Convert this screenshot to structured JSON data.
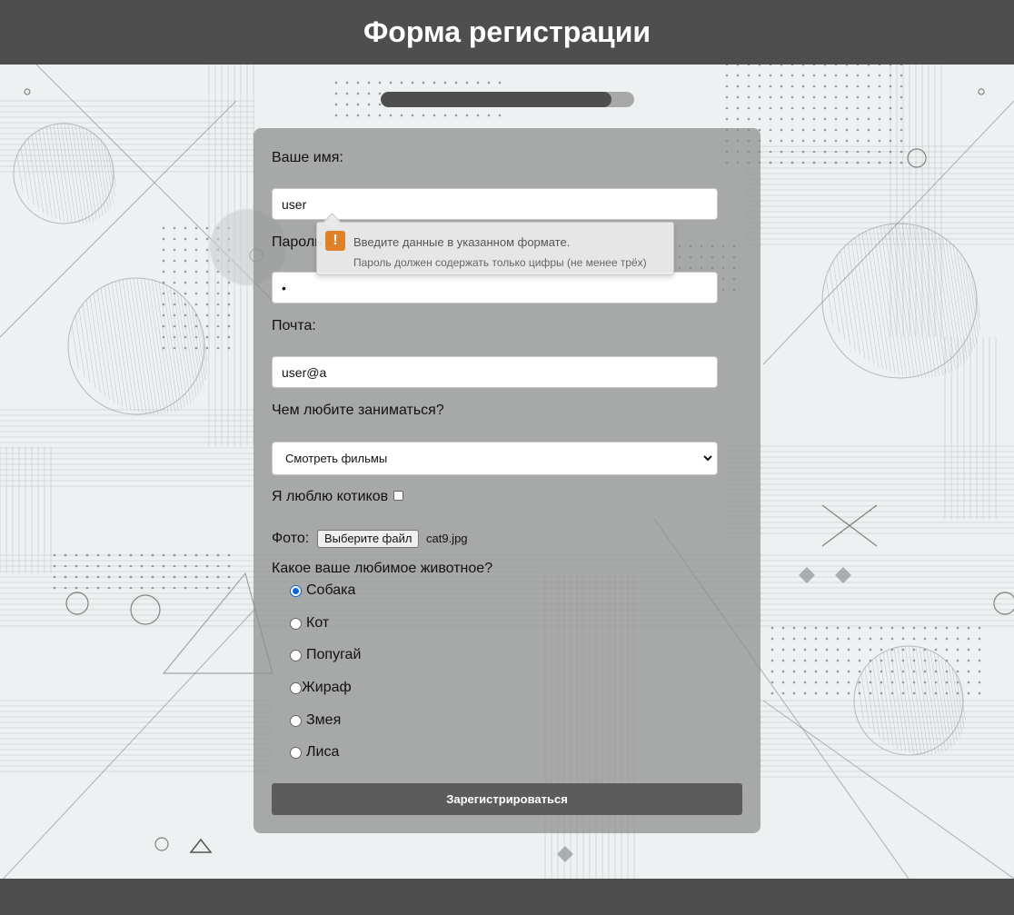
{
  "header": {
    "title": "Форма регистрации"
  },
  "progress": {
    "value_percent": 91
  },
  "form": {
    "name_label": "Ваше имя:",
    "name_value": "user",
    "password_label": "Пароль:",
    "password_value": "•",
    "email_label": "Почта:",
    "email_value": "user@a",
    "hobby_label": "Чем любите заниматься?",
    "hobby_selected": "Смотреть фильмы",
    "cats_label": "Я люблю котиков",
    "cats_checked": false,
    "photo_label": "Фото:",
    "file_button": "Выберите файл",
    "file_name": "cat9.jpg",
    "animal_label": "Какое ваше любимое животное?",
    "animals": [
      {
        "label": "Собака",
        "checked": true
      },
      {
        "label": "Кот",
        "checked": false
      },
      {
        "label": "Попугай",
        "checked": false
      },
      {
        "label": "Жираф",
        "checked": false
      },
      {
        "label": "Змея",
        "checked": false
      },
      {
        "label": "Лиса",
        "checked": false
      }
    ],
    "submit_label": "Зарегистрироваться"
  },
  "tooltip": {
    "title": "Введите данные в указанном формате.",
    "message": "Пароль должен содержать только цифры (не менее трёх)"
  },
  "colors": {
    "header_bg": "#4e4e4e",
    "radio_accent": "#0b63d1",
    "warning": "#e0812a"
  }
}
